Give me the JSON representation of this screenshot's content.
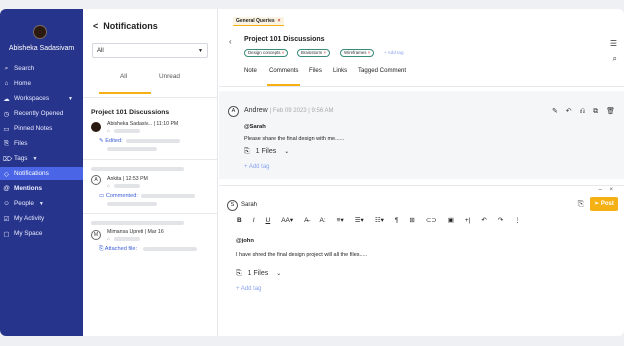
{
  "sidebar": {
    "user_name": "Abisheka Sadasivam",
    "items": [
      {
        "label": "Search",
        "icon": "search-icon",
        "glyph": "⌕"
      },
      {
        "label": "Home",
        "icon": "home-icon",
        "glyph": "⌂"
      },
      {
        "label": "Workspaces",
        "icon": "workspaces-icon",
        "glyph": "☁",
        "chevron": true
      },
      {
        "label": "Recently Opened",
        "icon": "clock-icon",
        "glyph": "◷"
      },
      {
        "label": "Pinned Notes",
        "icon": "note-icon",
        "glyph": "▭"
      },
      {
        "label": "Files",
        "icon": "clip-icon",
        "glyph": "⎘"
      },
      {
        "label": "Tags",
        "icon": "tag-icon",
        "glyph": "⌦",
        "chevron": true
      },
      {
        "label": "Notifications",
        "icon": "bell-icon",
        "glyph": "◇",
        "active": true
      },
      {
        "label": "Mentions",
        "icon": "at-icon",
        "glyph": "@",
        "bold": true
      },
      {
        "label": "People",
        "icon": "people-icon",
        "glyph": "☺",
        "chevron": true
      },
      {
        "label": "My Activity",
        "icon": "activity-icon",
        "glyph": "☑"
      },
      {
        "label": "My Space",
        "icon": "space-icon",
        "glyph": "▢"
      }
    ]
  },
  "notifications": {
    "title": "Notifications",
    "back_glyph": "<",
    "filter_value": "All",
    "tabs": [
      "All",
      "Unread"
    ],
    "cards": [
      {
        "title": "Project 101 Discussions",
        "avatar": "",
        "meta": "Abisheka Sadasiv...  |  11:10 PM",
        "action": "Edited:",
        "action_glyph": "✎"
      },
      {
        "title": "",
        "avatar": "A",
        "meta": "Ankita  |  12:53 PM",
        "action": "Commented:",
        "action_glyph": "▭"
      },
      {
        "title": "",
        "avatar": "M",
        "meta": "Mimansa Upreti  |  Mar 16",
        "action": "Attached file:",
        "action_glyph": "⎘"
      }
    ]
  },
  "detail": {
    "top_chip": "General Queries",
    "title": "Project 101 Discussions",
    "tags": [
      "Design concepts",
      "Brainstorm",
      "Wireframes"
    ],
    "add_tag_small": "+ Add tag",
    "tabs": [
      "Note",
      "Comments",
      "Files",
      "Links",
      "Tagged Comment"
    ],
    "active_tab": "Comments",
    "comment": {
      "avatar": "A",
      "author": "Andrew",
      "date": "|  Feb 09 2023  |  9:56 AM",
      "mention": "@Sarah",
      "body": "Please share the final design with me......",
      "files": "1 Files",
      "add_tag": "+ Add tag",
      "actions": "✎ ↶ ⎌ ⧉ 🗑"
    },
    "composer": {
      "avatar": "S",
      "name": "Sarah",
      "post_label": "Post",
      "mention": "@john",
      "body": "I have shred the final design project will all the files.....",
      "files": "1 Files",
      "add_tag": "+ Add tag",
      "toolbar": [
        "B",
        "I",
        "U",
        "AA▾",
        "A̶",
        "A:",
        "≡▾",
        "☰▾",
        "☷▾",
        "¶",
        "⊞",
        "⊂⊃",
        "▣",
        "+|",
        "↶",
        "↷",
        "⋮"
      ],
      "window_controls": "–  ×"
    }
  },
  "colors": {
    "sidebar_bg": "#27348b",
    "active_item": "#4a66e6",
    "accent": "#f5b014",
    "link": "#3c5dd8"
  }
}
